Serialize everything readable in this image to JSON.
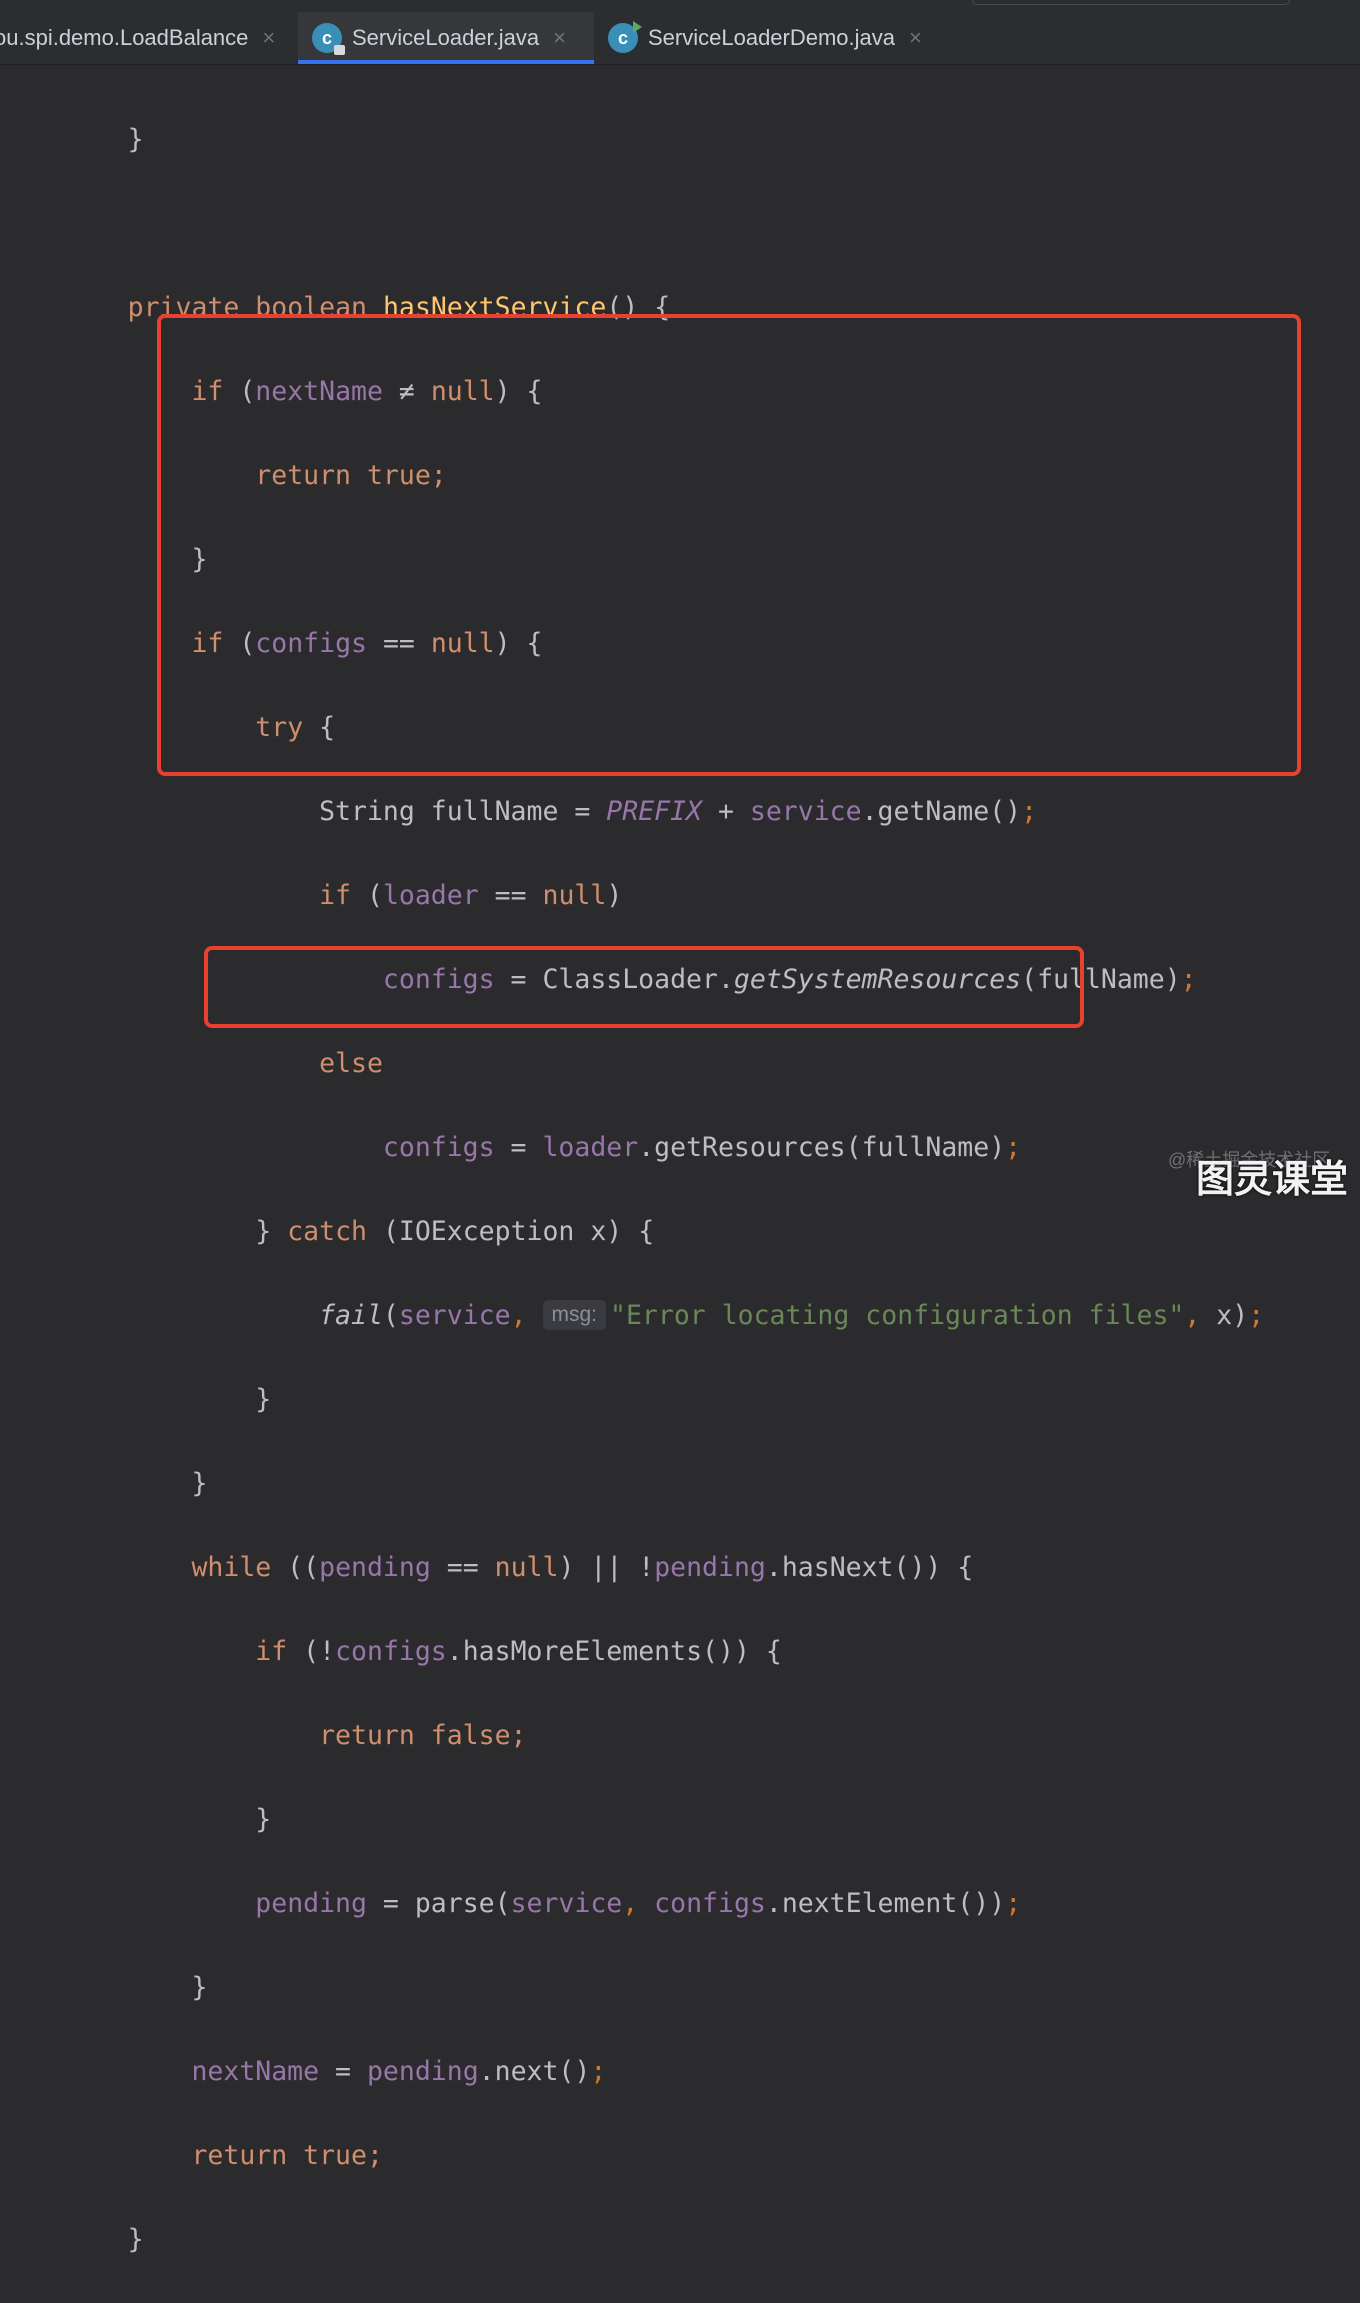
{
  "tabs": [
    {
      "label": "ou.spi.demo.LoadBalance",
      "icon": "none",
      "active": false
    },
    {
      "label": "ServiceLoader.java",
      "icon": "java-class-locked-icon",
      "active": true
    },
    {
      "label": "ServiceLoaderDemo.java",
      "icon": "java-class-runnable-icon",
      "active": false
    }
  ],
  "close_glyph": "×",
  "code": {
    "prev_brace": "}",
    "sig_private": "private",
    "sig_boolean": "boolean",
    "sig_method": "hasNextService",
    "sig_tail": "() {",
    "if1_kw": "if",
    "if1_open": " (",
    "if1_var": "nextName",
    "if1_op": " ≠ ",
    "if1_null": "null",
    "if1_close": ") {",
    "ret1": "return true;",
    "brace1": "}",
    "if2_kw": "if",
    "if2_open": " (",
    "if2_var": "configs",
    "if2_op": " == ",
    "if2_null": "null",
    "if2_close": ") {",
    "try_kw": "try",
    "try_brace": " {",
    "full_type": "String fullName = ",
    "full_prefix": "PREFIX",
    "full_plus": " + ",
    "full_service": "service",
    "full_call": ".getName()",
    "full_semi": ";",
    "if3_kw": "if",
    "if3_open": " (",
    "if3_var": "loader",
    "if3_op": " == ",
    "if3_null": "null",
    "if3_close": ")",
    "cfg1_var": "configs",
    "cfg1_eq": " = ClassLoader.",
    "cfg1_method": "getSystemResources",
    "cfg1_args": "(fullName)",
    "cfg1_semi": ";",
    "else_kw": "else",
    "cfg2_var": "configs",
    "cfg2_eq": " = ",
    "cfg2_loader": "loader",
    "cfg2_call": ".getResources(fullName)",
    "cfg2_semi": ";",
    "catch_open": "} ",
    "catch_kw": "catch",
    "catch_tail": " (IOException x) {",
    "fail_method": "fail",
    "fail_paren": "(",
    "fail_service": "service",
    "fail_comma": ", ",
    "fail_hint": "msg:",
    "fail_string": "\"Error locating configuration files\"",
    "fail_comma2": ", ",
    "fail_tail": "x)",
    "fail_semi": ";",
    "brace_try_end": "}",
    "brace_if2_end": "}",
    "while_kw": "while",
    "while_open": " ((",
    "while_pending1": "pending",
    "while_op": " == ",
    "while_null": "null",
    "while_or": ") || !",
    "while_pending2": "pending",
    "while_call": ".hasNext()) {",
    "if4_kw": "if",
    "if4_open": " (!",
    "if4_var": "configs",
    "if4_call": ".hasMoreElements()) {",
    "ret2": "return false;",
    "brace_if4_end": "}",
    "pend_var": "pending",
    "pend_eq": " = parse(",
    "pend_service": "service",
    "pend_comma": ", ",
    "pend_configs": "configs",
    "pend_call": ".nextElement())",
    "pend_semi": ";",
    "brace_while_end": "}",
    "nn_var": "nextName",
    "nn_eq": " = ",
    "nn_pending": "pending",
    "nn_call": ".next()",
    "nn_semi": ";",
    "ret3": "return true;",
    "brace_method_end": "}"
  },
  "highlight_color": "#e8412f",
  "watermark_small": "@稀土掘金技术社区",
  "watermark_big": "图灵课堂"
}
